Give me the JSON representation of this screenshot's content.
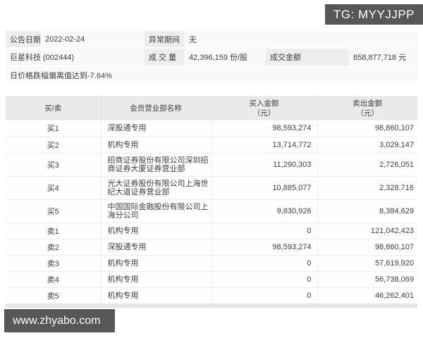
{
  "watermarks": {
    "tg_badge": "TG: MYYJJPP",
    "site_badge": "www.zhyabo.com"
  },
  "info": {
    "announce_date_label": "公告日期",
    "announce_date": "2022-02-24",
    "abnormal_period_label": "异常期间",
    "abnormal_period": "无",
    "stock": "巨星科技 (002444)",
    "volume_label": "成 交 量",
    "volume": "42,396,159 份/股",
    "turnover_label": "成交金额",
    "turnover": "858,877,718 元",
    "note": "日价格跌幅偏离值达到-7.64%"
  },
  "table": {
    "col_buy_sell": "买/卖",
    "col_dept": "会员营业部名称",
    "col_buy_amount": "买入金额",
    "col_sell_amount": "卖出金额",
    "col_unit": "（元）",
    "rows": [
      {
        "side": "买1",
        "dept": "深股通专用",
        "buy": "98,593,274",
        "sell": "98,860,107"
      },
      {
        "side": "买2",
        "dept": "机构专用",
        "buy": "13,714,772",
        "sell": "3,029,147"
      },
      {
        "side": "买3",
        "dept": "招商证券股份有限公司深圳招商证券大厦证券营业部",
        "buy": "11,290,303",
        "sell": "2,726,051"
      },
      {
        "side": "买4",
        "dept": "光大证券股份有限公司上海世纪大道证券营业部",
        "buy": "10,885,077",
        "sell": "2,328,716"
      },
      {
        "side": "买5",
        "dept": "中国国际金融股份有限公司上海分公司",
        "buy": "9,830,926",
        "sell": "8,384,629"
      },
      {
        "side": "卖1",
        "dept": "机构专用",
        "buy": "0",
        "sell": "121,042,423"
      },
      {
        "side": "卖2",
        "dept": "深股通专用",
        "buy": "98,593,274",
        "sell": "98,860,107"
      },
      {
        "side": "卖3",
        "dept": "机构专用",
        "buy": "0",
        "sell": "57,619,920"
      },
      {
        "side": "卖4",
        "dept": "机构专用",
        "buy": "0",
        "sell": "56,738,069"
      },
      {
        "side": "卖5",
        "dept": "机构专用",
        "buy": "0",
        "sell": "46,262,401"
      }
    ]
  },
  "colors": {
    "badge_bg": "#575757",
    "label_bg": "#ededed",
    "value_bg": "#f9f9f9",
    "table_header_bg": "#eaeaea",
    "border": "#ececec",
    "text": "#3e3e3e"
  }
}
